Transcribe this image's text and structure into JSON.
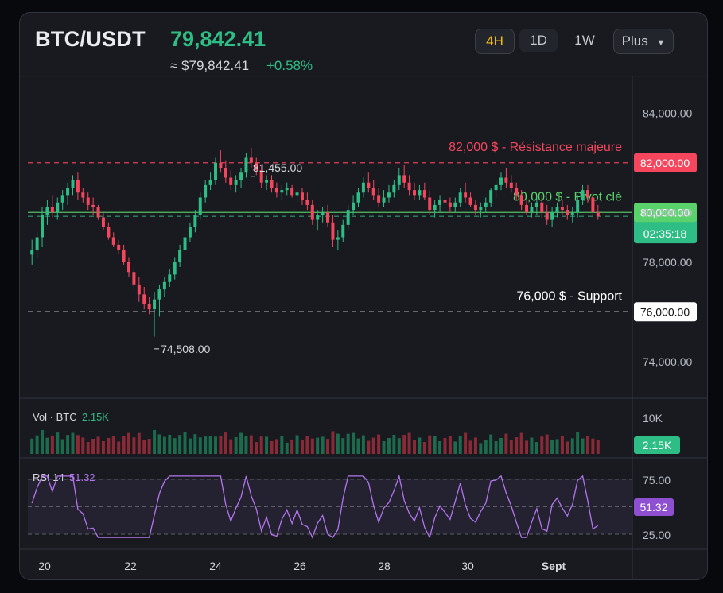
{
  "header": {
    "pair": "BTC/USDT",
    "price": "79,842.41",
    "approx": "≈ $79,842.41",
    "change": "+0.58%"
  },
  "timeframes": [
    {
      "label": "4H",
      "active": true
    },
    {
      "label": "1D",
      "active": false
    },
    {
      "label": "1W",
      "active": false
    },
    {
      "label": "Plus",
      "active": false
    }
  ],
  "colors": {
    "up": "#2ebd85",
    "down": "#f6465d",
    "resistance": "#f6465d",
    "pivot": "#5ad26b",
    "support": "#ffffff",
    "current": "#2ebd85",
    "rsi": "#b476f0"
  },
  "chart_data": {
    "type": "candlestick",
    "y_axis": {
      "ticks": [
        "84,000.00",
        "80,000.00",
        "78,000.00",
        "74,000.00"
      ],
      "tick_values": [
        84000,
        80000,
        78000,
        74000
      ],
      "range": [
        73000,
        85000
      ]
    },
    "x_axis": {
      "ticks": [
        "20",
        "22",
        "24",
        "26",
        "28",
        "30",
        "Sept"
      ]
    },
    "lines": [
      {
        "name": "resistance",
        "value": 82000,
        "axis_label": "82,000.00",
        "annotation": "82,000 $ - Résistance majeure",
        "style": "dashed"
      },
      {
        "name": "current",
        "value": 79842.41,
        "axis_label": "79,842.41",
        "countdown": "02:35:18",
        "style": "dashed"
      },
      {
        "name": "pivot",
        "value": 80000,
        "axis_label": "80,000.00",
        "annotation": "80,000 $ - Pivot clé",
        "style": "solid"
      },
      {
        "name": "support",
        "value": 76000,
        "axis_label": "76,000.00",
        "annotation": "76,000 $ - Support",
        "style": "dashed"
      }
    ],
    "annotations": [
      {
        "label": "81,455.00",
        "value": 81455
      },
      {
        "label": "74,508.00",
        "value": 74508
      }
    ],
    "candles": [
      [
        78300,
        78900,
        77900,
        78500
      ],
      [
        78500,
        79200,
        78200,
        79000
      ],
      [
        79000,
        80200,
        78600,
        79900
      ],
      [
        79900,
        80500,
        79500,
        80200
      ],
      [
        80200,
        80700,
        79800,
        80000
      ],
      [
        80000,
        80600,
        79700,
        80400
      ],
      [
        80400,
        80900,
        80100,
        80700
      ],
      [
        80700,
        81200,
        80300,
        81000
      ],
      [
        81000,
        81500,
        80700,
        81300
      ],
      [
        81300,
        81600,
        80500,
        80800
      ],
      [
        80800,
        81000,
        80400,
        80600
      ],
      [
        80600,
        80800,
        80100,
        80300
      ],
      [
        80300,
        80600,
        79900,
        80200
      ],
      [
        80200,
        80300,
        79700,
        79800
      ],
      [
        79800,
        80000,
        79300,
        79400
      ],
      [
        79400,
        79600,
        78900,
        79000
      ],
      [
        79000,
        79200,
        78600,
        78700
      ],
      [
        78700,
        78900,
        78300,
        78500
      ],
      [
        78500,
        78700,
        77900,
        78000
      ],
      [
        78000,
        78200,
        77400,
        77600
      ],
      [
        77600,
        77800,
        76900,
        77100
      ],
      [
        77100,
        77400,
        76400,
        76700
      ],
      [
        76700,
        77000,
        76100,
        76300
      ],
      [
        76300,
        76600,
        75900,
        76100
      ],
      [
        76100,
        76800,
        75000,
        76500
      ],
      [
        76500,
        77100,
        75800,
        76900
      ],
      [
        76900,
        77400,
        76600,
        77200
      ],
      [
        77200,
        77700,
        77000,
        77500
      ],
      [
        77500,
        78200,
        77300,
        78000
      ],
      [
        78000,
        78700,
        77800,
        78500
      ],
      [
        78500,
        79200,
        78300,
        79000
      ],
      [
        79000,
        79600,
        78800,
        79400
      ],
      [
        79400,
        80100,
        79200,
        79900
      ],
      [
        79900,
        80800,
        79700,
        80600
      ],
      [
        80600,
        81300,
        80400,
        81100
      ],
      [
        81100,
        81600,
        80900,
        81300
      ],
      [
        81300,
        82200,
        81100,
        82000
      ],
      [
        82000,
        82500,
        81600,
        81800
      ],
      [
        81800,
        82100,
        81200,
        81400
      ],
      [
        81400,
        81700,
        80900,
        81100
      ],
      [
        81100,
        81500,
        80800,
        81300
      ],
      [
        81300,
        81800,
        81000,
        81600
      ],
      [
        81600,
        82400,
        81400,
        82200
      ],
      [
        82200,
        82600,
        81800,
        82000
      ],
      [
        82000,
        82200,
        81500,
        81700
      ],
      [
        81700,
        81900,
        81000,
        81200
      ],
      [
        81200,
        81500,
        80900,
        81300
      ],
      [
        81300,
        81500,
        80800,
        81000
      ],
      [
        81000,
        81200,
        80600,
        80800
      ],
      [
        80800,
        81100,
        80500,
        80900
      ],
      [
        80900,
        81200,
        80700,
        81000
      ],
      [
        81000,
        81100,
        80600,
        80700
      ],
      [
        80700,
        81000,
        80400,
        80800
      ],
      [
        80800,
        81000,
        80300,
        80500
      ],
      [
        80500,
        80800,
        80100,
        80300
      ],
      [
        80300,
        80500,
        79500,
        79700
      ],
      [
        79700,
        80100,
        79300,
        79900
      ],
      [
        79900,
        80200,
        79600,
        80000
      ],
      [
        80000,
        80300,
        79400,
        79600
      ],
      [
        79600,
        79900,
        78600,
        78900
      ],
      [
        78900,
        79300,
        78500,
        79000
      ],
      [
        79000,
        79700,
        78800,
        79500
      ],
      [
        79500,
        80300,
        79300,
        80100
      ],
      [
        80100,
        80700,
        79900,
        80400
      ],
      [
        80400,
        81000,
        80200,
        80800
      ],
      [
        80800,
        81400,
        80600,
        81200
      ],
      [
        81200,
        81600,
        80800,
        81000
      ],
      [
        81000,
        81300,
        80500,
        80700
      ],
      [
        80700,
        81000,
        80200,
        80400
      ],
      [
        80400,
        80900,
        80200,
        80600
      ],
      [
        80600,
        81100,
        80400,
        80800
      ],
      [
        80800,
        81300,
        80600,
        81100
      ],
      [
        81100,
        81800,
        80900,
        81500
      ],
      [
        81500,
        81900,
        81000,
        81200
      ],
      [
        81200,
        81500,
        80700,
        80900
      ],
      [
        80900,
        81200,
        80500,
        80700
      ],
      [
        80700,
        81100,
        80500,
        80900
      ],
      [
        80900,
        81200,
        80500,
        80600
      ],
      [
        80600,
        80900,
        79900,
        80100
      ],
      [
        80100,
        80500,
        79800,
        80300
      ],
      [
        80300,
        80700,
        80000,
        80500
      ],
      [
        80500,
        80800,
        80100,
        80400
      ],
      [
        80400,
        80600,
        80000,
        80200
      ],
      [
        80200,
        80600,
        80000,
        80400
      ],
      [
        80400,
        81000,
        80200,
        80800
      ],
      [
        80800,
        81200,
        80400,
        80600
      ],
      [
        80600,
        80800,
        80200,
        80300
      ],
      [
        80300,
        80500,
        79900,
        80100
      ],
      [
        80100,
        80400,
        79800,
        80200
      ],
      [
        80200,
        80600,
        80000,
        80400
      ],
      [
        80400,
        81000,
        80200,
        80900
      ],
      [
        80900,
        81300,
        80600,
        81100
      ],
      [
        81100,
        81600,
        80900,
        81400
      ],
      [
        81400,
        81800,
        81000,
        81200
      ],
      [
        81200,
        81500,
        80800,
        81000
      ],
      [
        81000,
        81200,
        80500,
        80700
      ],
      [
        80700,
        80900,
        80100,
        80300
      ],
      [
        80300,
        80500,
        79900,
        80000
      ],
      [
        80000,
        80400,
        79800,
        80200
      ],
      [
        80200,
        80600,
        79900,
        80400
      ],
      [
        80400,
        80700,
        79800,
        80000
      ],
      [
        80000,
        80300,
        79500,
        79700
      ],
      [
        79700,
        80200,
        79400,
        80000
      ],
      [
        80000,
        80400,
        79800,
        80200
      ],
      [
        80200,
        80500,
        79900,
        80100
      ],
      [
        80100,
        80300,
        79700,
        79900
      ],
      [
        79900,
        80200,
        79600,
        80000
      ],
      [
        80000,
        80700,
        79800,
        80500
      ],
      [
        80500,
        81100,
        80300,
        80900
      ],
      [
        80900,
        81100,
        80400,
        80600
      ],
      [
        80600,
        80800,
        79800,
        80000
      ],
      [
        80000,
        80300,
        79700,
        79842
      ]
    ],
    "volume": {
      "label": "Vol · BTC",
      "value": "2.15K",
      "ticks": [
        "10K"
      ]
    },
    "rsi": {
      "label": "RSI 14",
      "value": "51.32",
      "ticks": [
        "75.00",
        "25.00"
      ]
    }
  }
}
